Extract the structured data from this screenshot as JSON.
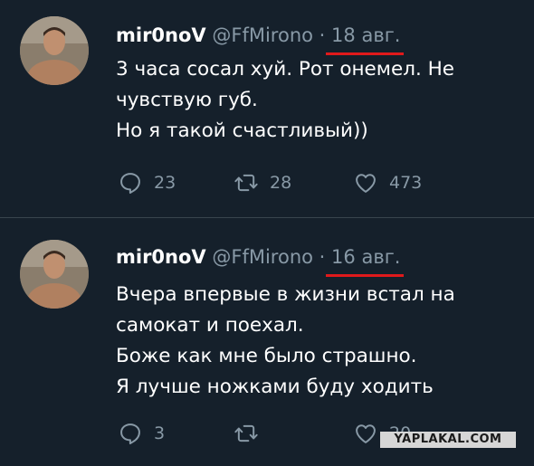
{
  "tweets": [
    {
      "author_name": "mir0noV",
      "author_handle": "@FfMirono",
      "separator": "·",
      "date": "18 авг.",
      "lines": [
        "3 часа сосал хуй.  Рот онемел.  Не",
        "чувствую губ.",
        "Но я такой счастливый))"
      ],
      "replies": "23",
      "retweets": "28",
      "likes": "473"
    },
    {
      "author_name": "mir0noV",
      "author_handle": "@FfMirono",
      "separator": "·",
      "date": "16 авг.",
      "lines": [
        "Вчера впервые в жизни встал на",
        "самокат и поехал.",
        "Боже как мне было страшно.",
        "Я лучше ножками буду ходить"
      ],
      "replies": "3",
      "retweets": "",
      "likes": "20"
    }
  ],
  "watermark": "YAPLAKAL.COM",
  "colors": {
    "background": "#15202b",
    "muted": "#8899a6",
    "highlight": "#e0191b",
    "divider": "#38444d"
  },
  "icons": [
    "avatar-photo",
    "reply-icon",
    "retweet-icon",
    "like-icon"
  ]
}
